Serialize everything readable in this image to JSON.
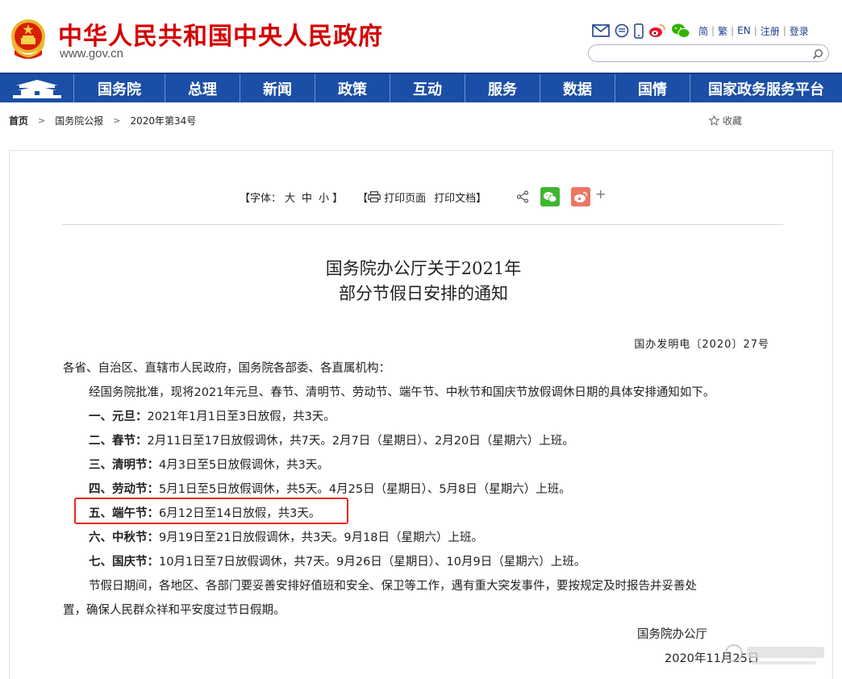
{
  "header": {
    "site_title": "中华人民共和国中央人民政府",
    "site_url": "www.gov.cn",
    "lang_links": [
      "简",
      "繁",
      "EN"
    ],
    "account_links": [
      "注册",
      "登录"
    ],
    "search_placeholder": ""
  },
  "nav": {
    "items": [
      "国务院",
      "总理",
      "新闻",
      "政策",
      "互动",
      "服务",
      "数据",
      "国情",
      "国家政务服务平台"
    ]
  },
  "breadcrumb": {
    "home": "首页",
    "items": [
      "国务院公报",
      "2020年第34号"
    ]
  },
  "favorite_label": "收藏",
  "toolbar": {
    "font_label": "【字体：",
    "font_sizes": [
      "大",
      "中",
      "小"
    ],
    "font_close": "】",
    "print_open": "【",
    "print_page": "打印页面",
    "print_doc": "打印文档",
    "print_close": "】"
  },
  "document": {
    "title_line1": "国务院办公厅关于2021年",
    "title_line2": "部分节假日安排的通知",
    "doc_number": "国办发明电〔2020〕27号",
    "salutation": "各省、自治区、直辖市人民政府，国务院各部委、各直属机构：",
    "intro": "经国务院批准，现将2021年元旦、春节、清明节、劳动节、端午节、中秋节和国庆节放假调休日期的具体安排通知如下。",
    "holidays": [
      {
        "name": "一、元旦：",
        "text": "2021年1月1日至3日放假，共3天。"
      },
      {
        "name": "二、春节：",
        "text": "2月11日至17日放假调休，共7天。2月7日（星期日）、2月20日（星期六）上班。"
      },
      {
        "name": "三、清明节：",
        "text": "4月3日至5日放假调休，共3天。"
      },
      {
        "name": "四、劳动节：",
        "text": "5月1日至5日放假调休，共5天。4月25日（星期日）、5月8日（星期六）上班。"
      },
      {
        "name": "五、端午节：",
        "text": "6月12日至14日放假，共3天。"
      },
      {
        "name": "六、中秋节：",
        "text": "9月19日至21日放假调休，共3天。9月18日（星期六）上班。"
      },
      {
        "name": "七、国庆节：",
        "text": "10月1日至7日放假调休，共7天。9月26日（星期日）、10月9日（星期六）上班。"
      }
    ],
    "closing_line1": "节假日期间，各地区、各部门要妥善安排好值班和安全、保卫等工作，遇有重大突发事件，要按规定及时报告并妥善处",
    "closing_line2": "置，确保人民群众祥和平安度过节日假期。",
    "signer": "国务院办公厅",
    "date": "2020年11月25日"
  },
  "colors": {
    "brand_red": "#d30000",
    "nav_blue": "#1b4ea6",
    "highlight_red": "#e8281e"
  },
  "icons": [
    "email-icon",
    "message-icon",
    "mobile-icon",
    "weibo-icon",
    "wechat-icon",
    "search-icon",
    "star-icon",
    "printer-icon",
    "share-icon"
  ]
}
